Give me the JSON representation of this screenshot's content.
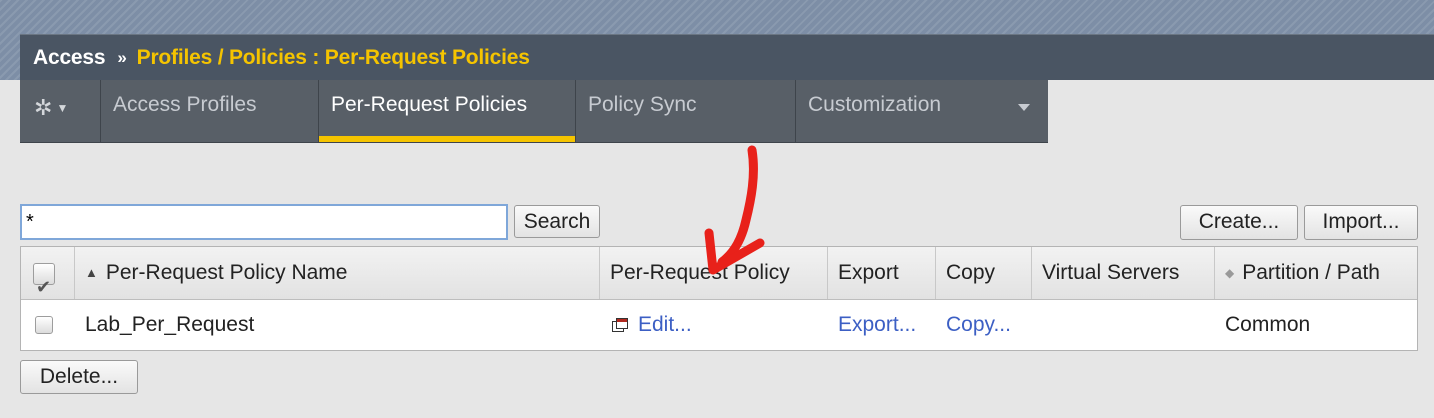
{
  "breadcrumb": {
    "root": "Access",
    "separator": "»",
    "path": "Profiles / Policies : Per-Request Policies"
  },
  "tabs": [
    {
      "label": "Access Profiles",
      "active": false
    },
    {
      "label": "Per-Request Policies",
      "active": true
    },
    {
      "label": "Policy Sync",
      "active": false
    },
    {
      "label": "Customization",
      "active": false,
      "has_dropdown": true
    }
  ],
  "toolbar": {
    "search_value": "*",
    "search_label": "Search",
    "create_label": "Create...",
    "import_label": "Import..."
  },
  "table": {
    "columns": [
      {
        "label": "Per-Request Policy Name",
        "sort": "ascending"
      },
      {
        "label": "Per-Request Policy"
      },
      {
        "label": "Export"
      },
      {
        "label": "Copy"
      },
      {
        "label": "Virtual Servers"
      },
      {
        "label": "Partition / Path",
        "sort": "none"
      }
    ],
    "rows": [
      {
        "name": "Lab_Per_Request",
        "edit": "Edit...",
        "export": "Export...",
        "copy": "Copy...",
        "virtual_servers": "",
        "partition": "Common"
      }
    ]
  },
  "footer": {
    "delete_label": "Delete..."
  },
  "colors": {
    "accent": "#f5c400",
    "title_bar": "#4a5563",
    "tab_bar": "#585f67",
    "link": "#3c5fc4",
    "annotation_arrow": "#e8211a"
  },
  "icons": [
    "gear-icon",
    "chevron-down-icon",
    "checkmark-icon",
    "sort-ascending-icon",
    "sort-icon",
    "window-icon"
  ]
}
